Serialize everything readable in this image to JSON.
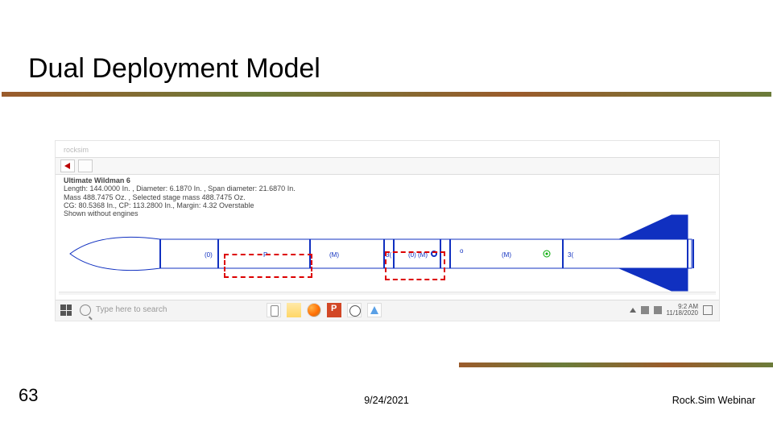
{
  "slide": {
    "title": "Dual Deployment Model",
    "page_number": "63",
    "date": "9/24/2021",
    "footer_title": "Rock.Sim Webinar"
  },
  "app": {
    "name": "rocksim"
  },
  "rocket": {
    "name": "Ultimate Wildman 6",
    "spec_line2": "Length: 144.0000 In. , Diameter: 6.1870 In. , Span diameter: 21.6870 In.",
    "spec_line3": "Mass 488.7475 Oz. , Selected stage mass 488.7475 Oz.",
    "spec_line4": "CG: 80.5368 In., CP: 113.2800 In., Margin: 4.32 Overstable",
    "spec_line5": "Shown without engines"
  },
  "taskbar": {
    "search_placeholder": "Type here to search",
    "clock_time": "9:2 AM",
    "clock_date": "11/18/2020"
  }
}
